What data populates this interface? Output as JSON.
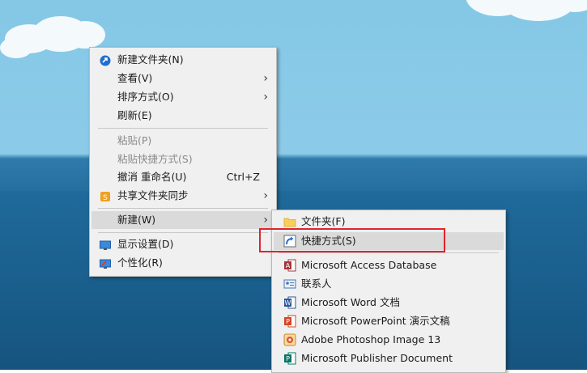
{
  "context_menu": {
    "items": [
      {
        "label": "新建文件夹(N)",
        "icon": "new-folder-pin-icon"
      },
      {
        "label": "查看(V)",
        "submenu": true
      },
      {
        "label": "排序方式(O)",
        "submenu": true
      },
      {
        "label": "刷新(E)"
      },
      {
        "label": "粘贴(P)",
        "disabled": true
      },
      {
        "label": "粘贴快捷方式(S)",
        "disabled": true
      },
      {
        "label": "撤消 重命名(U)",
        "shortcut": "Ctrl+Z"
      },
      {
        "label": "共享文件夹同步",
        "icon": "sync-s-icon",
        "submenu": true
      },
      {
        "label": "新建(W)",
        "submenu": true,
        "highlighted": true
      },
      {
        "label": "显示设置(D)",
        "icon": "display-settings-icon"
      },
      {
        "label": "个性化(R)",
        "icon": "personalize-icon"
      }
    ]
  },
  "new_submenu": {
    "items": [
      {
        "label": "文件夹(F)",
        "icon": "folder-icon"
      },
      {
        "label": "快捷方式(S)",
        "icon": "shortcut-icon",
        "highlighted": true
      },
      {
        "label": "Microsoft Access Database",
        "icon": "access-icon"
      },
      {
        "label": "联系人",
        "icon": "contact-icon"
      },
      {
        "label": "Microsoft Word 文档",
        "icon": "word-icon"
      },
      {
        "label": "Microsoft PowerPoint 演示文稿",
        "icon": "powerpoint-icon"
      },
      {
        "label": "Adobe Photoshop Image 13",
        "icon": "photoshop-icon"
      },
      {
        "label": "Microsoft Publisher Document",
        "icon": "publisher-icon"
      }
    ]
  },
  "colors": {
    "highlight": "#dadada",
    "annotation_box": "#e0242b"
  }
}
